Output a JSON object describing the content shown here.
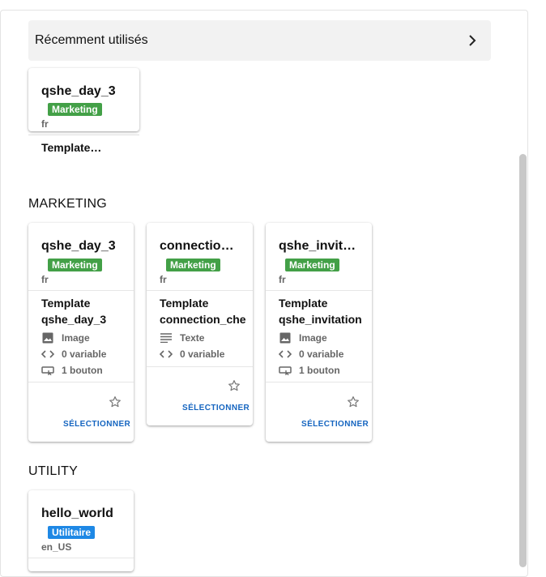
{
  "recent": {
    "title": "Récemment utilisés",
    "card": {
      "name": "qshe_day_3",
      "category": "Marketing",
      "lang": "fr",
      "template": "Template…"
    }
  },
  "sections": {
    "marketing": {
      "title": "MARKETING",
      "cards": [
        {
          "name": "qshe_day_3",
          "category": "Marketing",
          "lang": "fr",
          "template_line1": "Template",
          "template_line2": "qshe_day_3",
          "media": "Image",
          "variables": "0 variable",
          "buttons": "1 bouton",
          "select": "SÉLECTIONNER"
        },
        {
          "name": "connection…",
          "category": "Marketing",
          "lang": "fr",
          "template_line1": "Template",
          "template_line2": "connection_che",
          "media": "Texte",
          "variables": "0 variable",
          "select": "SÉLECTIONNER"
        },
        {
          "name": "qshe_invita…",
          "category": "Marketing",
          "lang": "fr",
          "template_line1": "Template",
          "template_line2": "qshe_invitation",
          "media": "Image",
          "variables": "0 variable",
          "buttons": "1 bouton",
          "select": "SÉLECTIONNER"
        }
      ]
    },
    "utility": {
      "title": "UTILITY",
      "cards": [
        {
          "name": "hello_world",
          "category": "Utilitaire",
          "lang": "en_US"
        }
      ]
    }
  },
  "colors": {
    "marketing_badge": "#43a047",
    "utility_badge": "#1e88e5",
    "select_link": "#1565c0"
  },
  "icons": [
    "chevron-right-icon",
    "image-icon",
    "text-icon",
    "code-icon",
    "button-icon",
    "star-outline-icon"
  ]
}
